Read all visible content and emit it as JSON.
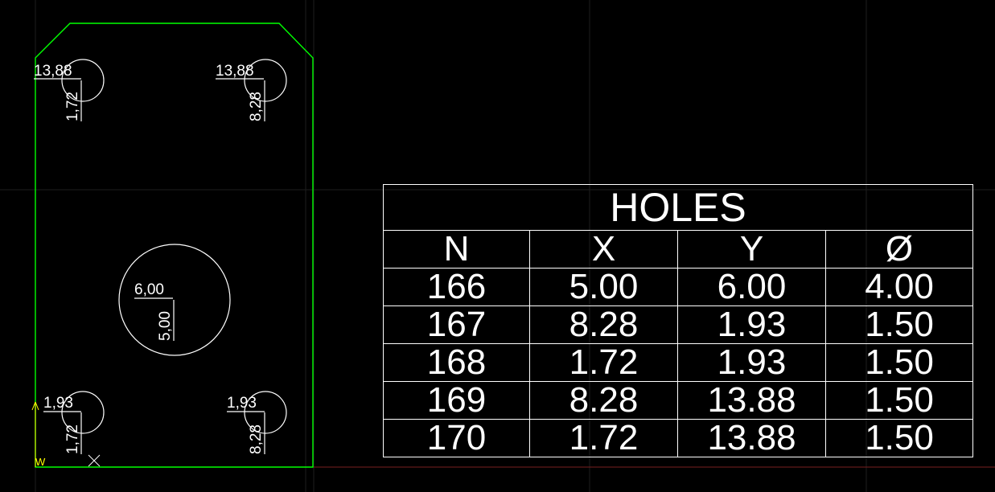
{
  "colors": {
    "background": "#000000",
    "part_outline": "#00ff00",
    "geometry": "#ffffff",
    "ucs_icon": "#ffff00",
    "grid_lines": "#1e1e1e",
    "axis_x": "#7a1f1f"
  },
  "drawing": {
    "ucs_label": "W",
    "holes": [
      {
        "id": "hole-166",
        "x_label": "6,00",
        "y_label": "5,00"
      },
      {
        "id": "hole-167",
        "x_label": "1,93",
        "y_label": "8,28"
      },
      {
        "id": "hole-168",
        "x_label": "1,93",
        "y_label": "1,72"
      },
      {
        "id": "hole-169",
        "x_label": "13,88",
        "y_label": "8,28"
      },
      {
        "id": "hole-170",
        "x_label": "13,88",
        "y_label": "1,72"
      }
    ]
  },
  "table": {
    "title": "HOLES",
    "headers": [
      "N",
      "X",
      "Y",
      "Ø"
    ],
    "rows": [
      [
        "166",
        "5.00",
        "6.00",
        "4.00"
      ],
      [
        "167",
        "8.28",
        "1.93",
        "1.50"
      ],
      [
        "168",
        "1.72",
        "1.93",
        "1.50"
      ],
      [
        "169",
        "8.28",
        "13.88",
        "1.50"
      ],
      [
        "170",
        "1.72",
        "13.88",
        "1.50"
      ]
    ]
  }
}
